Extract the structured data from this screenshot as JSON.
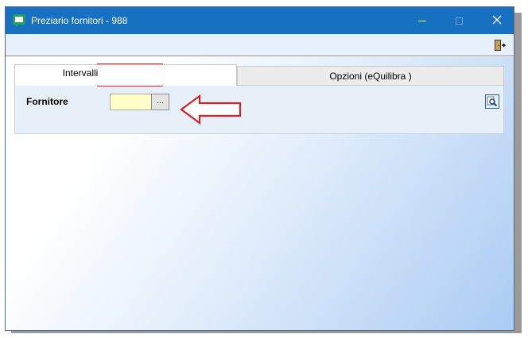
{
  "window": {
    "title": "Preziario fornitori - 988",
    "titlebar_color": "#1870c0"
  },
  "titlebar_buttons": {
    "minimize_icon": "minimize-icon",
    "maximize_icon": "maximize-icon",
    "close_glyph": "✕"
  },
  "toolbar": {
    "exit_icon": "exit-door-icon"
  },
  "tabs": [
    {
      "label": "Intervalli",
      "active": true
    },
    {
      "label": "Opzioni (eQuilibra )",
      "active": false
    }
  ],
  "filter": {
    "supplier_label": "Fornitore",
    "supplier_value": "",
    "browse_label": "...",
    "search_icon": "search-icon"
  },
  "annotations": {
    "highlight_color": "#d4202a",
    "arrow_icon": "red-arrow-left-icon"
  }
}
